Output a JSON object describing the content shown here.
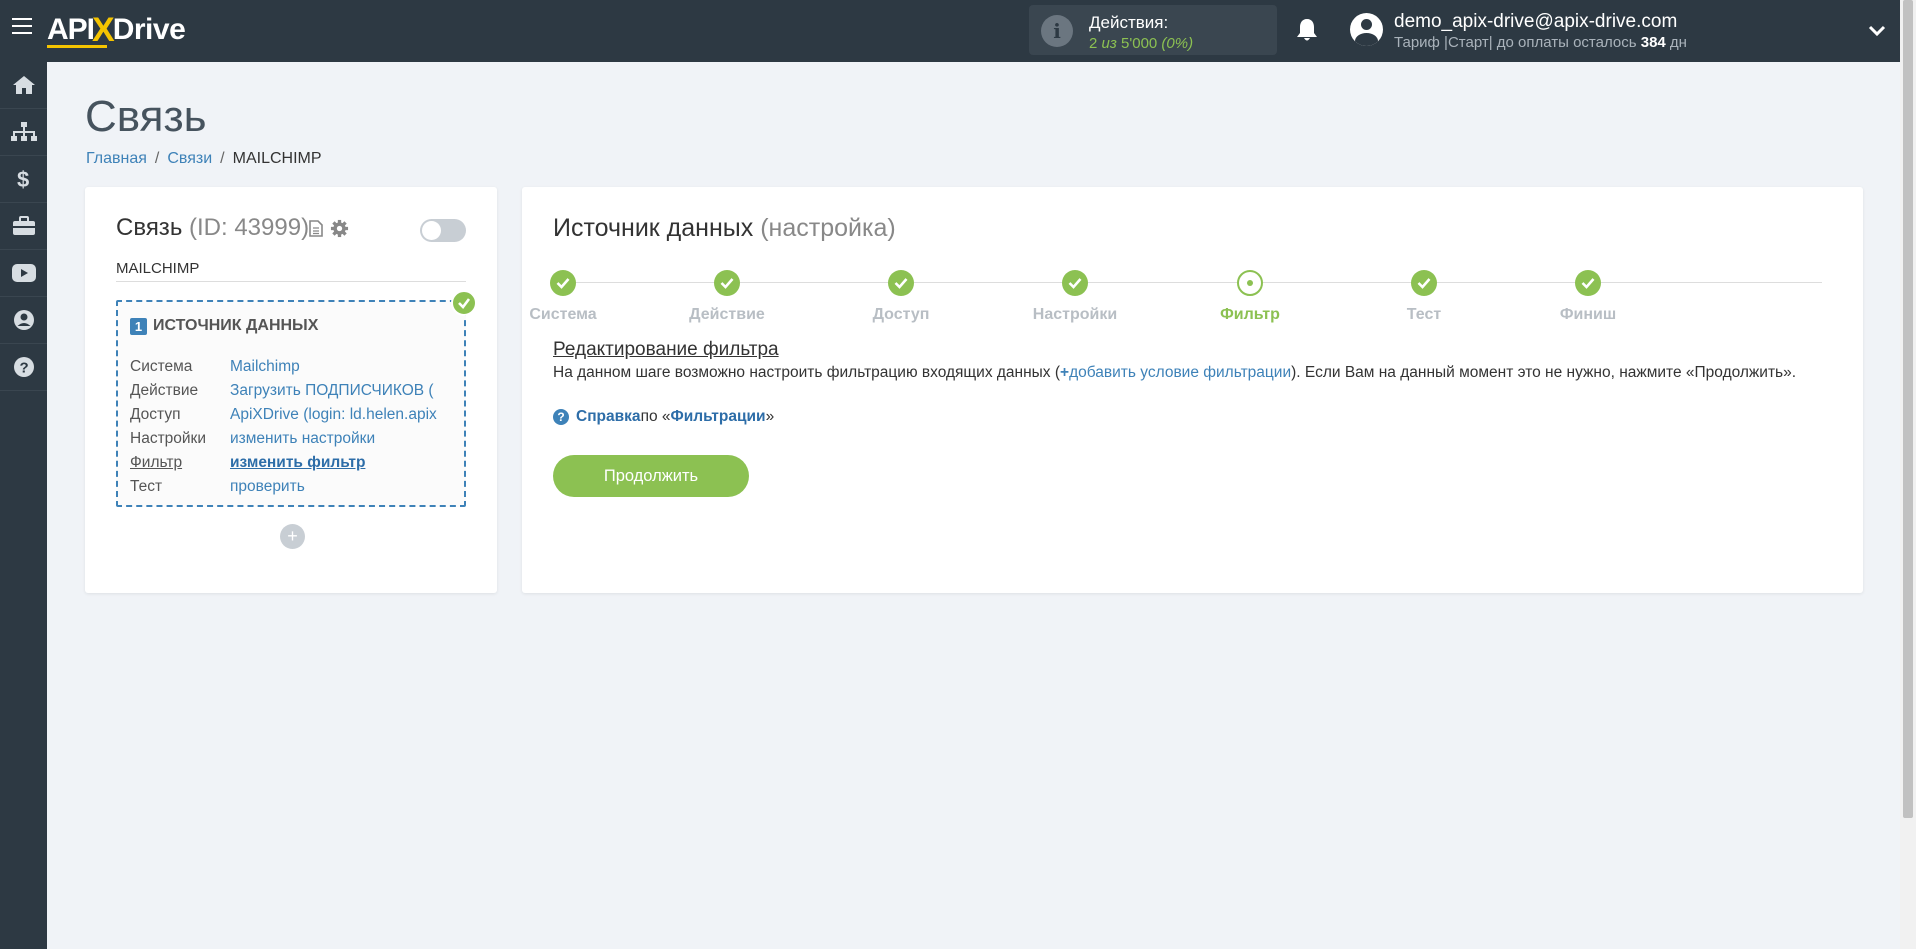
{
  "header": {
    "logo": {
      "api": "API",
      "x": "X",
      "drive": "Drive"
    },
    "actions_label": "Действия:",
    "actions_count": "2",
    "actions_of": "из",
    "actions_total": "5'000",
    "actions_percent": "(0%)",
    "user_email": "demo_apix-drive@apix-drive.com",
    "plan_prefix": "Тариф |Старт| до оплаты осталось ",
    "plan_days": "384",
    "plan_suffix": " дн"
  },
  "sidebar": {
    "items": [
      "home-icon",
      "sitemap-icon",
      "dollar-icon",
      "briefcase-icon",
      "youtube-icon",
      "user-circle-icon",
      "question-icon"
    ]
  },
  "page": {
    "title": "Связь",
    "breadcrumb": [
      "Главная",
      "Связи",
      "MAILCHIMP"
    ]
  },
  "connection": {
    "title": "Связь",
    "id_text": "(ID: 43999)",
    "name": "MAILCHIMP",
    "source": {
      "number": "1",
      "header": "ИСТОЧНИК ДАННЫХ",
      "rows": [
        {
          "key": "Система",
          "value": "Mailchimp"
        },
        {
          "key": "Действие",
          "value": "Загрузить ПОДПИСЧИКОВ ("
        },
        {
          "key": "Доступ",
          "value": "ApiXDrive (login: ld.helen.apix"
        },
        {
          "key": "Настройки",
          "value": "изменить настройки"
        },
        {
          "key": "Фильтр",
          "value": "изменить фильтр"
        },
        {
          "key": "Тест",
          "value": "проверить"
        }
      ]
    },
    "add_label": "+"
  },
  "main": {
    "title": "Источник данных",
    "title_paren": "(настройка)",
    "steps": [
      "Система",
      "Действие",
      "Доступ",
      "Настройки",
      "Фильтр",
      "Тест",
      "Финиш"
    ],
    "current_step": "Фильтр",
    "filter_title": "Редактирование фильтра",
    "filter_desc_before": "На данном шаге возможно настроить фильтрацию входящих данных (",
    "filter_link": "добавить условие фильтрации",
    "filter_desc_after": "). Если Вам на данный момент это не нужно, нажмите «Продолжить».",
    "help_bold": "Справка",
    "help_mid": " по «",
    "help_link": "Фильтрации",
    "help_end": "»",
    "continue_label": "Продолжить"
  },
  "colors": {
    "topbar": "#2d3943",
    "accent_green": "#8cc152",
    "link_blue": "#3e82b8",
    "background": "#f0f3f7"
  }
}
